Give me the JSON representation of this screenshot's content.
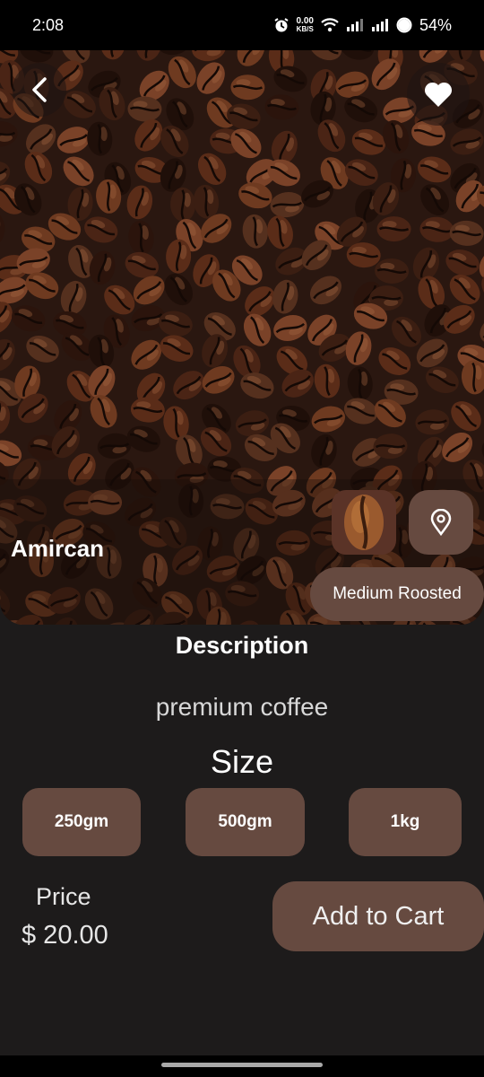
{
  "status_bar": {
    "time": "2:08",
    "net_speed_value": "0.00",
    "net_speed_unit": "KB/S",
    "battery": "54%",
    "icons": [
      "alarm-icon",
      "wifi-icon",
      "signal-icon",
      "signal-icon",
      "battery-icon"
    ]
  },
  "product": {
    "name": "Amircan",
    "roast": "Medium Roosted"
  },
  "description": {
    "title": "Description",
    "text": "premium coffee"
  },
  "size": {
    "title": "Size",
    "options": [
      "250gm",
      "500gm",
      "1kg"
    ]
  },
  "price": {
    "label": "Price",
    "value": "$ 20.00"
  },
  "cart": {
    "label": "Add to Cart"
  },
  "colors": {
    "background": "#1d1b1b",
    "chip": "#664a40",
    "bean_chip": "#5a3327"
  }
}
